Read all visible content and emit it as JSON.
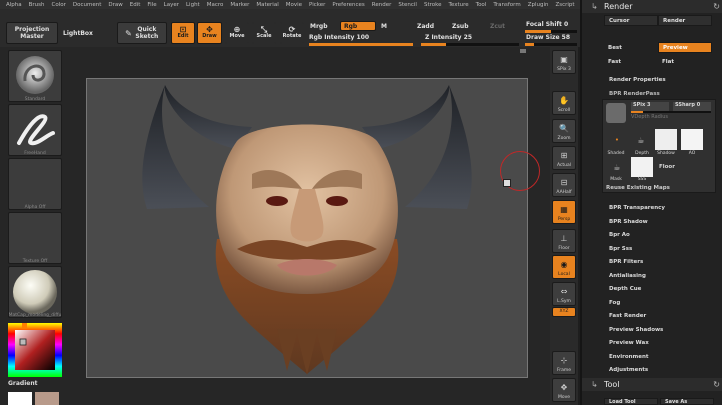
{
  "menubar": [
    "Alpha",
    "Brush",
    "Color",
    "Document",
    "Draw",
    "Edit",
    "File",
    "Layer",
    "Light",
    "Macro",
    "Marker",
    "Material",
    "Movie",
    "Picker",
    "Preferences",
    "Render",
    "Stencil",
    "Stroke",
    "Texture",
    "Tool",
    "Transform",
    "Zplugin",
    "Zscript"
  ],
  "toolbar": {
    "projection_master": "Projection Master",
    "lightbox": "LightBox",
    "quick_sketch": "Quick Sketch",
    "edit": "Edit",
    "draw": "Draw",
    "move": "Move",
    "scale": "Scale",
    "rotate": "Rotate",
    "mrgb": "Mrgb",
    "rgb": "Rgb",
    "m": "M",
    "rgb_intensity_label": "Rgb Intensity",
    "rgb_intensity_value": "100",
    "zadd": "Zadd",
    "zsub": "Zsub",
    "zcut": "Zcut",
    "z_intensity_label": "Z Intensity",
    "z_intensity_value": "25",
    "focal_shift_label": "Focal Shift",
    "focal_shift_value": "0",
    "draw_size_label": "Draw Size",
    "draw_size_value": "58"
  },
  "leftshelf": {
    "brush1": "Standard",
    "brush2": "FreeHand",
    "alpha": "Alpha Off",
    "texture": "Texture Off",
    "material": "MatCap_modeling_diffu",
    "gradient": "Gradient"
  },
  "rightshelf": [
    "SPix 3",
    "Scroll",
    "Zoom",
    "Actual",
    "AAHalf",
    "Persp",
    "Floor",
    "Local",
    "L.Sym",
    "XYZ",
    "",
    "",
    "Frame",
    "Move"
  ],
  "rpanel": {
    "render_title": "Render",
    "cursor": "Cursor",
    "render_btn": "Render",
    "best": "Best",
    "preview": "Preview",
    "fast": "Fast",
    "flat": "Flat",
    "render_properties": "Render Properties",
    "bpr_renderpass": "BPR RenderPass",
    "spix": "SPix 3",
    "ssharp": "SSharp 0",
    "vdepth": "VDepth Radius",
    "passes": [
      "Shaded",
      "Depth",
      "Shadow",
      "AO"
    ],
    "mask": "Mask",
    "sss": "SSS",
    "floor": "Floor",
    "reuse": "Reuse Existing Maps",
    "submenus": [
      "BPR Transparency",
      "BPR Shadow",
      "Bpr Ao",
      "Bpr Sss",
      "BPR Filters",
      "Antialiasing",
      "Depth Cue",
      "Fog",
      "Fast Render",
      "Preview Shadows",
      "Preview Wax",
      "Environment",
      "Adjustments"
    ],
    "tool_title": "Tool",
    "load_tool": "Load Tool",
    "save_as": "Save As"
  },
  "colors": {
    "accent": "#e8831f"
  }
}
